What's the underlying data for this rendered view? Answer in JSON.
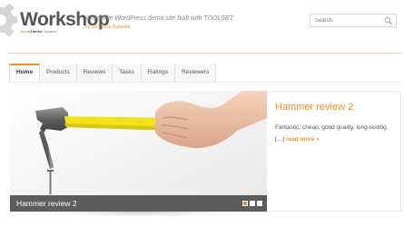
{
  "header": {
    "site_title": "Workshop",
    "logo_by": "by",
    "logo_brand_on": "on",
    "logo_brand_rest": "TheGo",
    "logo_brand_suffix": "Systems",
    "tagline": "A real live WordPress demo site built with TOOLSET",
    "tagline_by": "by OnTheGo Systems"
  },
  "search": {
    "placeholder": "Search"
  },
  "nav": {
    "tabs": [
      {
        "label": "Home",
        "active": true
      },
      {
        "label": "Products"
      },
      {
        "label": "Reviews"
      },
      {
        "label": "Tasks"
      },
      {
        "label": "Ratings"
      },
      {
        "label": "Reviewers"
      }
    ]
  },
  "slider": {
    "caption": "Hammer review 2",
    "slides_count": 3,
    "current_slide": 1
  },
  "panel": {
    "title": "Hammer review 2",
    "excerpt": "Fantastic, cheap, good quality, long-lasting.",
    "ellipsis": "[…]",
    "read_more": "read more »"
  },
  "colors": {
    "accent": "#f28c28",
    "hammer_handle": "#f2e21a",
    "brand_green": "#7ab317"
  }
}
